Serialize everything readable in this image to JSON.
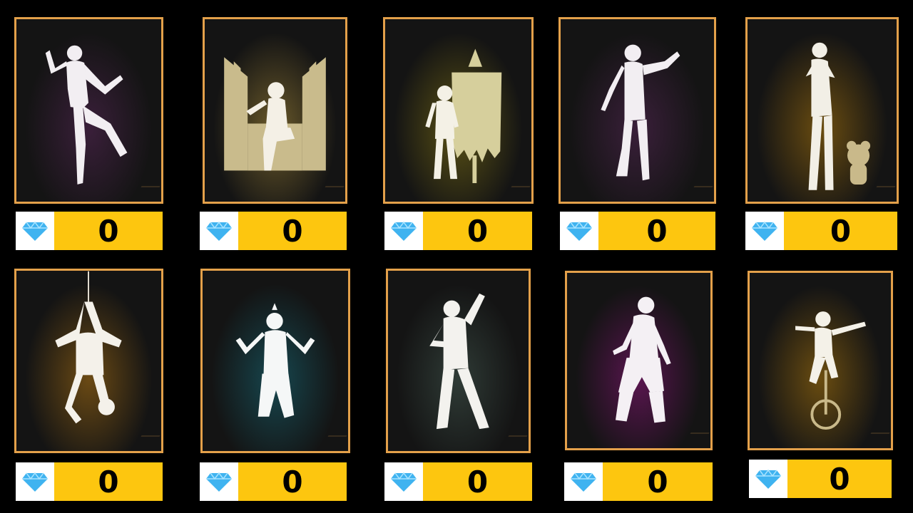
{
  "emotes": [
    {
      "name": "dance-kick",
      "glow": "#3a1f3a",
      "price": "0",
      "currency_icon": "diamond-icon"
    },
    {
      "name": "throne",
      "glow": "#6b5a2a",
      "price": "0",
      "currency_icon": "diamond-icon"
    },
    {
      "name": "banner-flag",
      "glow": "#5b5215",
      "price": "0",
      "currency_icon": "diamond-icon"
    },
    {
      "name": "point-pose",
      "glow": "#3a1f3a",
      "price": "0",
      "currency_icon": "diamond-icon"
    },
    {
      "name": "mic-with-pet",
      "glow": "#6b4d10",
      "price": "0",
      "currency_icon": "diamond-icon"
    },
    {
      "name": "hanging-rope",
      "glow": "#6b4a14",
      "price": "0",
      "currency_icon": "diamond-icon"
    },
    {
      "name": "kneel-flex",
      "glow": "#16474f",
      "price": "0",
      "currency_icon": "diamond-icon"
    },
    {
      "name": "dab-pose",
      "glow": "#2f3b36",
      "price": "0",
      "currency_icon": "diamond-icon"
    },
    {
      "name": "hoodie-dance",
      "glow": "#5a1550",
      "price": "0",
      "currency_icon": "diamond-icon"
    },
    {
      "name": "unicycle",
      "glow": "#6b4d10",
      "price": "0",
      "currency_icon": "diamond-icon"
    }
  ],
  "colors": {
    "border": "#e3a04a",
    "price_bg": "#fdc60f",
    "gem": "#3fb3f0"
  }
}
